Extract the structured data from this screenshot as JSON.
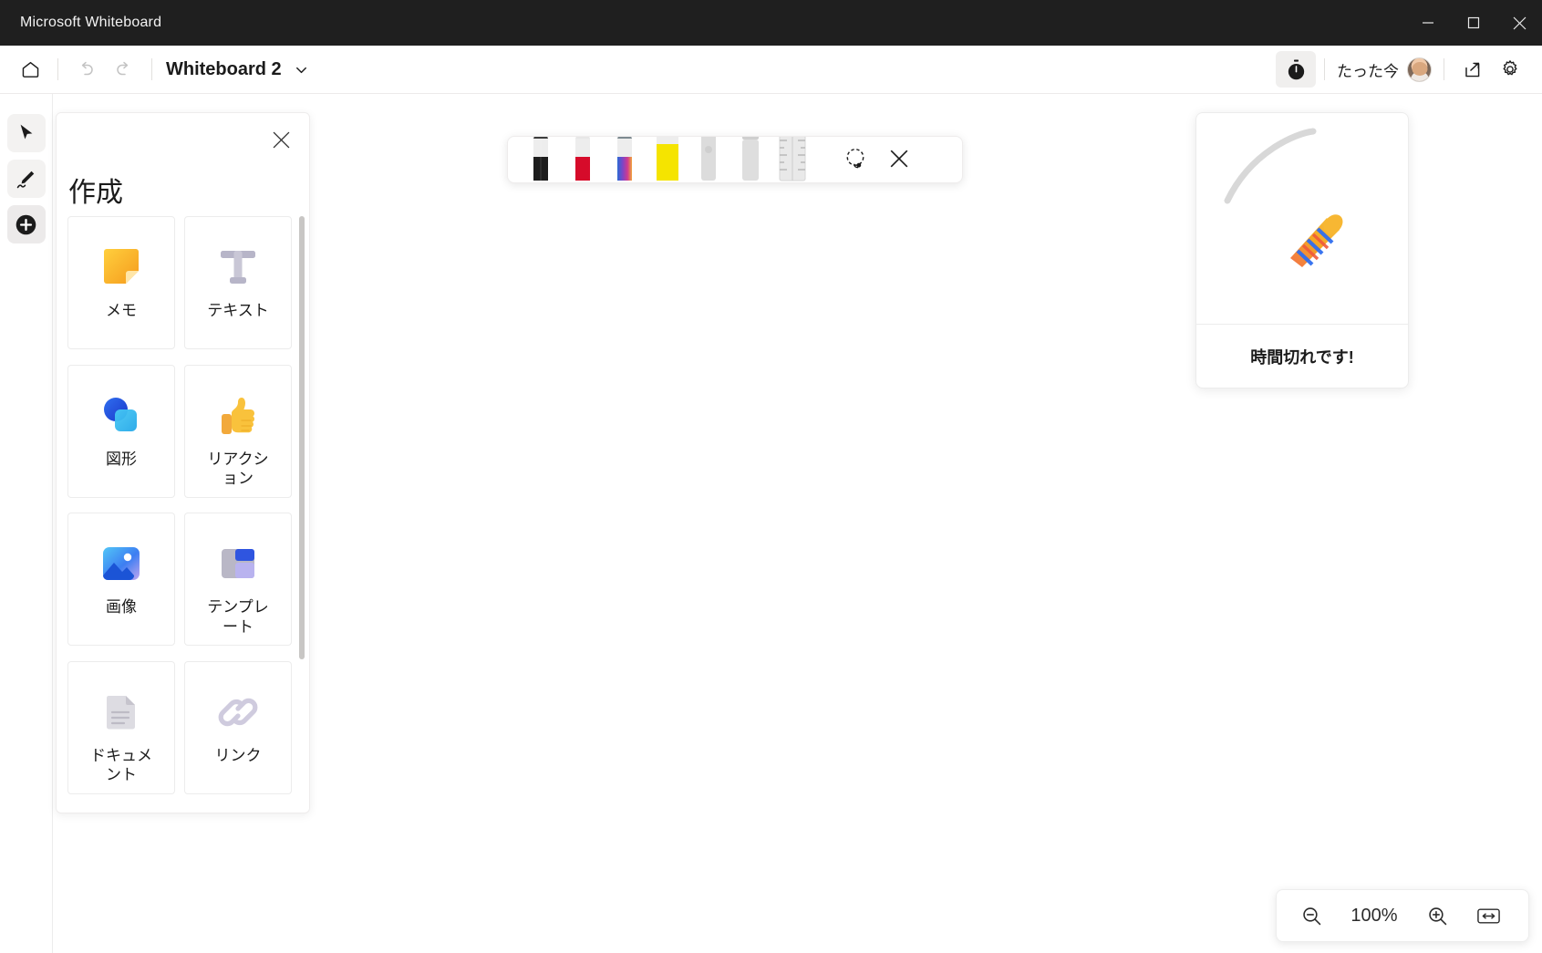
{
  "window": {
    "app_title": "Microsoft Whiteboard",
    "controls": [
      {
        "name": "minimize",
        "glyph": "minimize-icon"
      },
      {
        "name": "maximize",
        "glyph": "maximize-icon"
      },
      {
        "name": "close",
        "glyph": "close-icon"
      }
    ]
  },
  "commandbar": {
    "home_label": "home-icon",
    "undo_label": "undo-icon",
    "redo_label": "redo-icon",
    "doc_title": "Whiteboard 2",
    "title_chevron": "chevron-down-icon",
    "timer_icon": "stopwatch-icon",
    "presence_text": "たった今",
    "share_icon": "share-icon",
    "settings_icon": "gear-icon"
  },
  "rail": {
    "items": [
      {
        "name": "select-tool",
        "icon": "cursor-arrow-icon",
        "active": false
      },
      {
        "name": "ink-tool",
        "icon": "pen-icon",
        "active": false
      },
      {
        "name": "create-tool",
        "icon": "plus-circle-icon",
        "active": true
      }
    ]
  },
  "create_panel": {
    "title": "作成",
    "close_icon": "close-icon",
    "cards": [
      {
        "label": "メモ",
        "icon": "sticky-note-icon"
      },
      {
        "label": "テキスト",
        "icon": "text-icon"
      },
      {
        "label": "図形",
        "icon": "shapes-icon"
      },
      {
        "label": "リアクション",
        "icon": "thumbs-up-icon"
      },
      {
        "label": "画像",
        "icon": "image-icon"
      },
      {
        "label": "テンプレート",
        "icon": "template-icon"
      },
      {
        "label": "ドキュメント",
        "icon": "document-icon"
      },
      {
        "label": "リンク",
        "icon": "link-icon"
      }
    ]
  },
  "pen_toolbar": {
    "pens": [
      {
        "name": "pen-black",
        "color": "#1d1d1d",
        "type": "pen"
      },
      {
        "name": "pen-red",
        "color": "#d60b2a",
        "type": "pen"
      },
      {
        "name": "pen-rainbow",
        "color": "#7a46c8",
        "type": "pen"
      },
      {
        "name": "highlighter-yellow",
        "color": "#f5e400",
        "type": "highlighter"
      },
      {
        "name": "eraser-small",
        "color": "#e8294a",
        "type": "eraser"
      },
      {
        "name": "eraser-large",
        "color": "#f48a9b",
        "type": "eraser"
      }
    ],
    "ruler_icon": "ruler-icon",
    "lasso_icon": "lasso-select-icon",
    "close_icon": "close-icon"
  },
  "timer_card": {
    "caption": "時間切れです!",
    "emoji_icon": "party-popper-icon",
    "arc_icon": "timer-arc-icon"
  },
  "zoom_controls": {
    "zoom_out_icon": "zoom-out-icon",
    "level": "100%",
    "zoom_in_icon": "zoom-in-icon",
    "fit_icon": "fit-to-screen-icon"
  },
  "colors": {
    "titlebar_bg": "#1f1f1f",
    "accent_blue": "#1452e8",
    "panel_border": "#ececec"
  }
}
